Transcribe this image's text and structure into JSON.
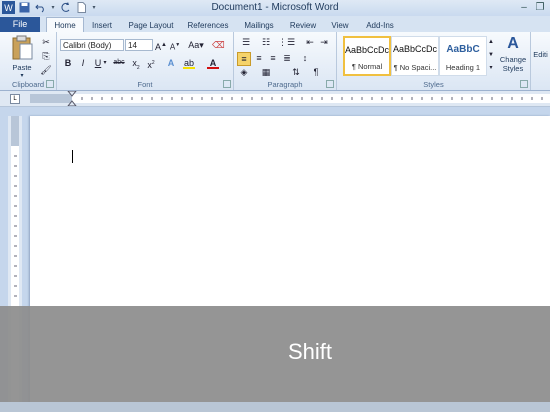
{
  "window": {
    "title": "Document1 - Microsoft Word"
  },
  "tabs": [
    {
      "label": "File"
    },
    {
      "label": "Home"
    },
    {
      "label": "Insert"
    },
    {
      "label": "Page Layout"
    },
    {
      "label": "References"
    },
    {
      "label": "Mailings"
    },
    {
      "label": "Review"
    },
    {
      "label": "View"
    },
    {
      "label": "Add-Ins"
    }
  ],
  "clipboard": {
    "paste_label": "Paste",
    "group_label": "Clipboard"
  },
  "font": {
    "name": "Calibri (Body)",
    "size": "14",
    "group_label": "Font"
  },
  "paragraph": {
    "group_label": "Paragraph"
  },
  "styles": {
    "group_label": "Styles",
    "items": [
      {
        "sample": "AaBbCcDc",
        "name": "¶ Normal"
      },
      {
        "sample": "AaBbCcDc",
        "name": "¶ No Spaci..."
      },
      {
        "sample": "AaBbC",
        "name": "Heading 1"
      }
    ],
    "change_label_1": "Change",
    "change_label_2": "Styles"
  },
  "editing": {
    "label": "Editi"
  },
  "overlay": {
    "key_text": "Shift"
  },
  "colors": {
    "file_tab": "#2b579a",
    "accent": "#f0c040"
  }
}
